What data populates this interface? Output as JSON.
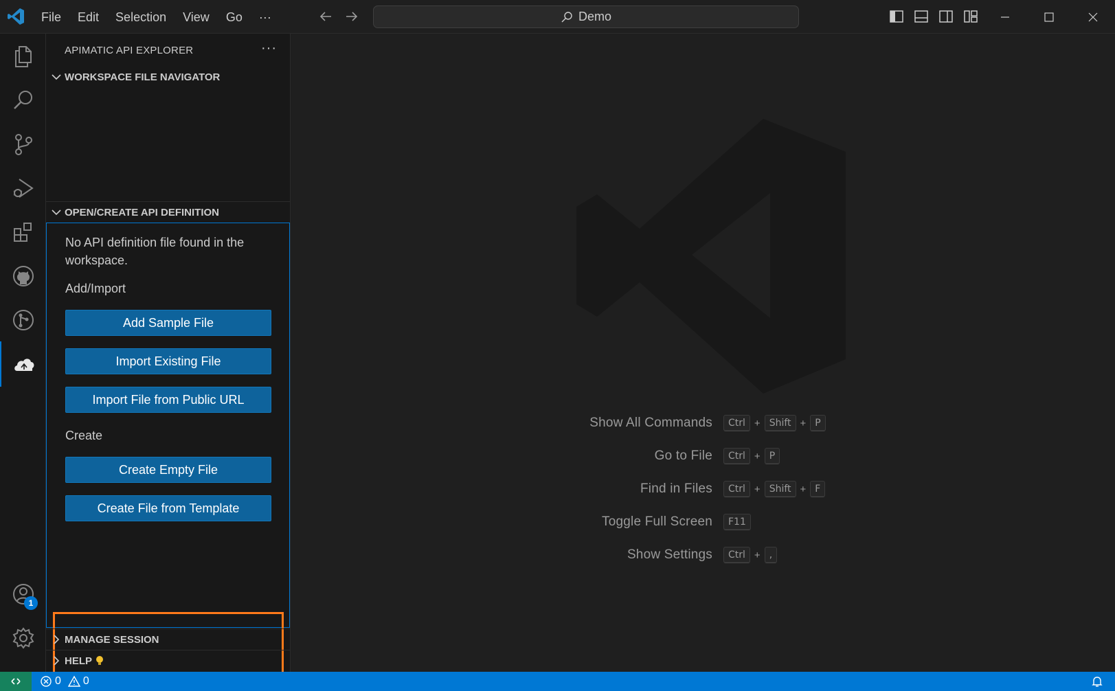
{
  "titlebar": {
    "menu": [
      "File",
      "Edit",
      "Selection",
      "View",
      "Go",
      "···"
    ],
    "search_text": "Demo"
  },
  "activitybar": {
    "items": [
      "explorer-icon",
      "search-icon",
      "source-control-icon",
      "run-debug-icon",
      "extensions-icon",
      "github-icon",
      "git-graph-icon",
      "apimatic-icon"
    ],
    "accounts_badge": "1"
  },
  "sidebar": {
    "title": "APIMATIC API EXPLORER",
    "more": "···",
    "sections": {
      "workspace_nav": "WORKSPACE FILE NAVIGATOR",
      "open_create": "OPEN/CREATE API DEFINITION",
      "manage_session": "MANAGE SESSION",
      "help": "HELP"
    },
    "panel": {
      "message": "No API definition file found in the workspace.",
      "add_import_heading": "Add/Import",
      "add_sample": "Add Sample File",
      "import_existing": "Import Existing File",
      "import_url": "Import File from Public URL",
      "create_heading": "Create",
      "create_empty": "Create Empty File",
      "create_template": "Create File from Template"
    }
  },
  "editor": {
    "shortcuts": [
      {
        "label": "Show All Commands",
        "keys": [
          "Ctrl",
          "Shift",
          "P"
        ]
      },
      {
        "label": "Go to File",
        "keys": [
          "Ctrl",
          "P"
        ]
      },
      {
        "label": "Find in Files",
        "keys": [
          "Ctrl",
          "Shift",
          "F"
        ]
      },
      {
        "label": "Toggle Full Screen",
        "keys": [
          "F11"
        ]
      },
      {
        "label": "Show Settings",
        "keys": [
          "Ctrl",
          ","
        ]
      }
    ]
  },
  "statusbar": {
    "errors": "0",
    "warnings": "0"
  },
  "colors": {
    "accent": "#0078d4",
    "button": "#0e639c",
    "highlight": "#ff7a1a",
    "remote": "#16825d"
  }
}
